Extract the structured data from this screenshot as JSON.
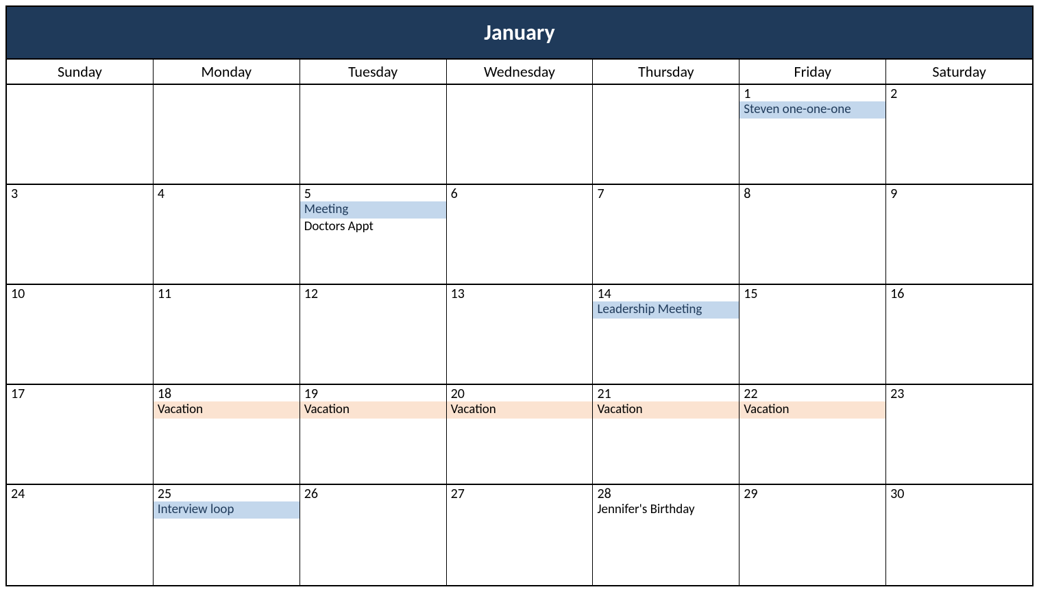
{
  "month_title": "January",
  "day_headers": [
    "Sunday",
    "Monday",
    "Tuesday",
    "Wednesday",
    "Thursday",
    "Friday",
    "Saturday"
  ],
  "weeks": [
    [
      {
        "num": "",
        "events": []
      },
      {
        "num": "",
        "events": []
      },
      {
        "num": "",
        "events": []
      },
      {
        "num": "",
        "events": []
      },
      {
        "num": "",
        "events": []
      },
      {
        "num": "1",
        "events": [
          {
            "label": "Steven one-one-one",
            "style": "blue"
          }
        ]
      },
      {
        "num": "2",
        "events": []
      }
    ],
    [
      {
        "num": "3",
        "events": []
      },
      {
        "num": "4",
        "events": []
      },
      {
        "num": "5",
        "events": [
          {
            "label": "Meeting",
            "style": "blue"
          },
          {
            "label": "Doctors Appt",
            "style": "plain"
          }
        ]
      },
      {
        "num": "6",
        "events": []
      },
      {
        "num": "7",
        "events": []
      },
      {
        "num": "8",
        "events": []
      },
      {
        "num": "9",
        "events": []
      }
    ],
    [
      {
        "num": "10",
        "events": []
      },
      {
        "num": "11",
        "events": []
      },
      {
        "num": "12",
        "events": []
      },
      {
        "num": "13",
        "events": []
      },
      {
        "num": "14",
        "events": [
          {
            "label": "Leadership Meeting",
            "style": "blue"
          }
        ]
      },
      {
        "num": "15",
        "events": []
      },
      {
        "num": "16",
        "events": []
      }
    ],
    [
      {
        "num": "17",
        "events": []
      },
      {
        "num": "18",
        "events": [
          {
            "label": "Vacation",
            "style": "orange"
          }
        ]
      },
      {
        "num": "19",
        "events": [
          {
            "label": "Vacation",
            "style": "orange"
          }
        ]
      },
      {
        "num": "20",
        "events": [
          {
            "label": "Vacation",
            "style": "orange"
          }
        ]
      },
      {
        "num": "21",
        "events": [
          {
            "label": "Vacation",
            "style": "orange"
          }
        ]
      },
      {
        "num": "22",
        "events": [
          {
            "label": "Vacation",
            "style": "orange"
          }
        ]
      },
      {
        "num": "23",
        "events": []
      }
    ],
    [
      {
        "num": "24",
        "events": []
      },
      {
        "num": "25",
        "events": [
          {
            "label": "Interview loop",
            "style": "blue"
          }
        ]
      },
      {
        "num": "26",
        "events": []
      },
      {
        "num": "27",
        "events": []
      },
      {
        "num": "28",
        "events": [
          {
            "label": "Jennifer's Birthday",
            "style": "plain"
          }
        ]
      },
      {
        "num": "29",
        "events": []
      },
      {
        "num": "30",
        "events": []
      }
    ]
  ]
}
